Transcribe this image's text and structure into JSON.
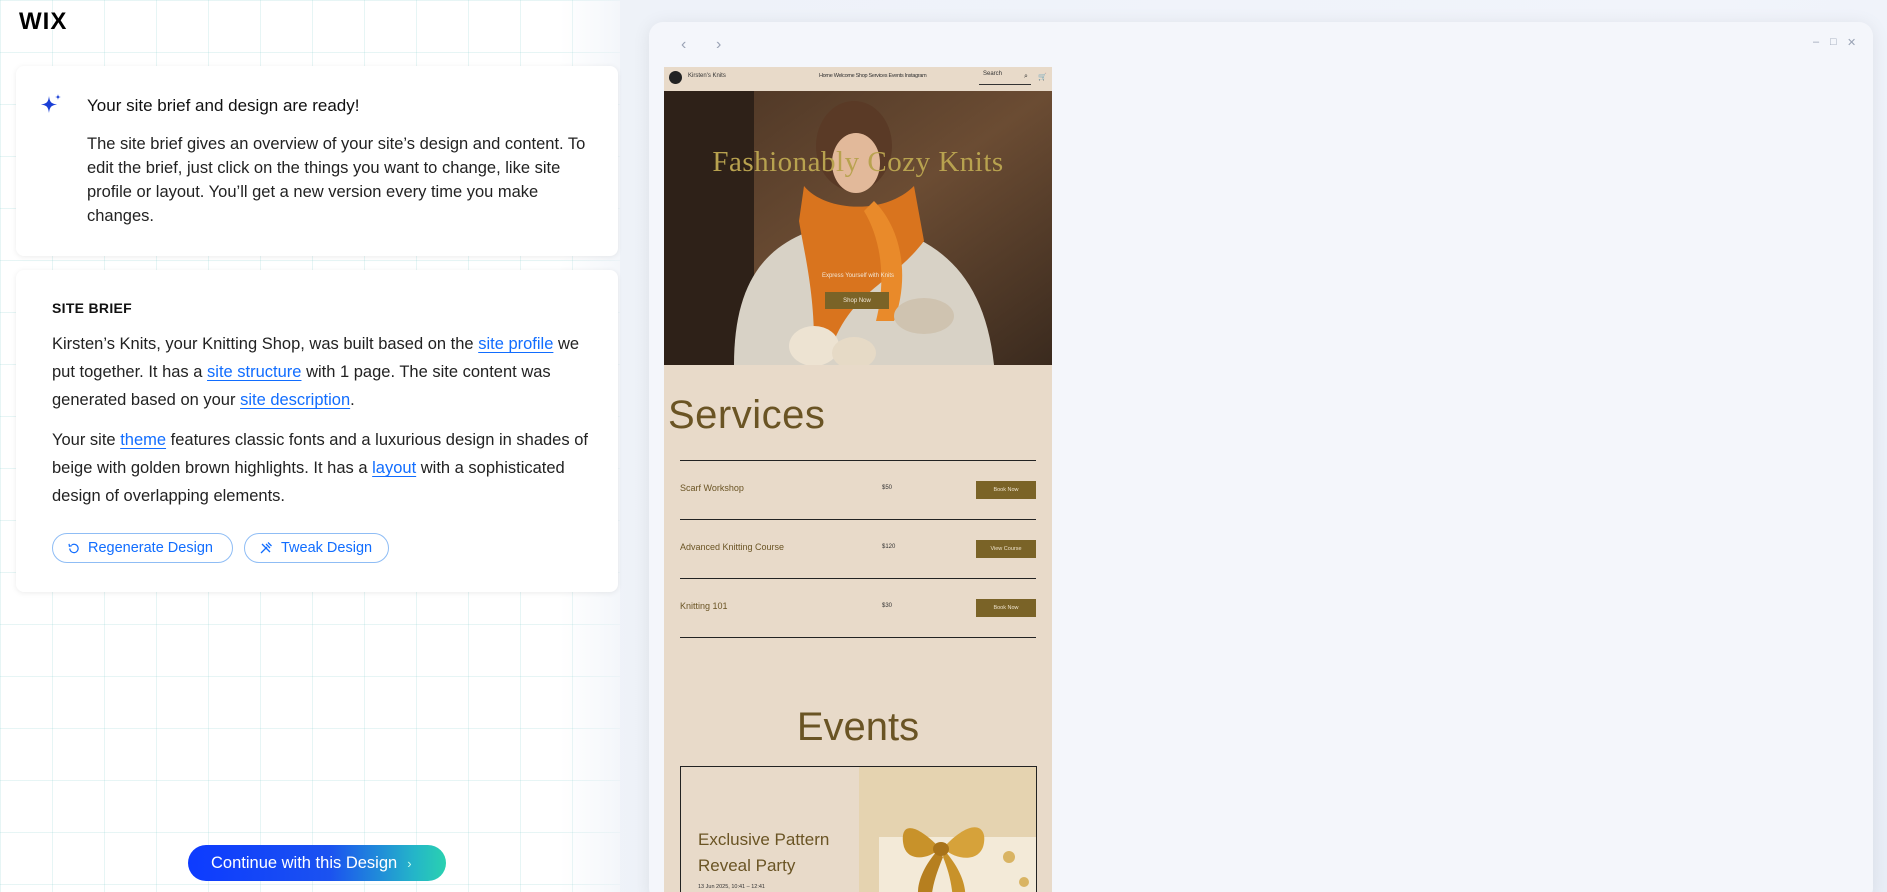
{
  "brand": {
    "logo": "WIX"
  },
  "intro": {
    "title": "Your site brief and design are ready!",
    "body": "The site brief gives an overview of your site’s design and content. To edit the brief, just click on the things you want to change, like site profile or layout. You’ll get a new version every time you make changes."
  },
  "brief": {
    "heading": "SITE BRIEF",
    "p1": {
      "t1": "Kirsten’s Knits, your Knitting Shop, was built based on the ",
      "link1": "site profile",
      "t2": " we put together. It has a ",
      "link2": "site structure",
      "t3": " with 1 page. The site content was generated based on your ",
      "link3": "site description",
      "t4": "."
    },
    "p2": {
      "t1": "Your site ",
      "link1": "theme",
      "t2": " features classic fonts and a luxurious design in shades of beige with golden brown highlights. It has a ",
      "link2": "layout",
      "t3": " with a sophisticated design of overlapping elements."
    },
    "regenerate_label": "Regenerate Design",
    "tweak_label": "Tweak Design"
  },
  "continue_label": "Continue with this Design",
  "preview": {
    "site_name": "Kirsten's Knits",
    "menu": "Home  Welcome  Shop  Services  Events  Instagram",
    "search_placeholder": "Search",
    "hero": {
      "title": "Fashionably Cozy Knits",
      "subtitle": "Express Yourself with Knits",
      "button": "Shop Now"
    },
    "services_title": "Services",
    "services": [
      {
        "name": "Scarf Workshop",
        "price": "$50",
        "button": "Book Now"
      },
      {
        "name": "Advanced Knitting Course",
        "price": "$120",
        "button": "View Course"
      },
      {
        "name": "Knitting 101",
        "price": "$30",
        "button": "Book Now"
      }
    ],
    "events_title": "Events",
    "event": {
      "name": "Exclusive Pattern Reveal Party",
      "date": "13 Jun 2025, 10:41 – 12:41"
    }
  },
  "colors": {
    "accent": "#116dff",
    "site_bg": "#e8dac9",
    "site_brown": "#6a5424",
    "site_gold": "#b8a24f"
  }
}
